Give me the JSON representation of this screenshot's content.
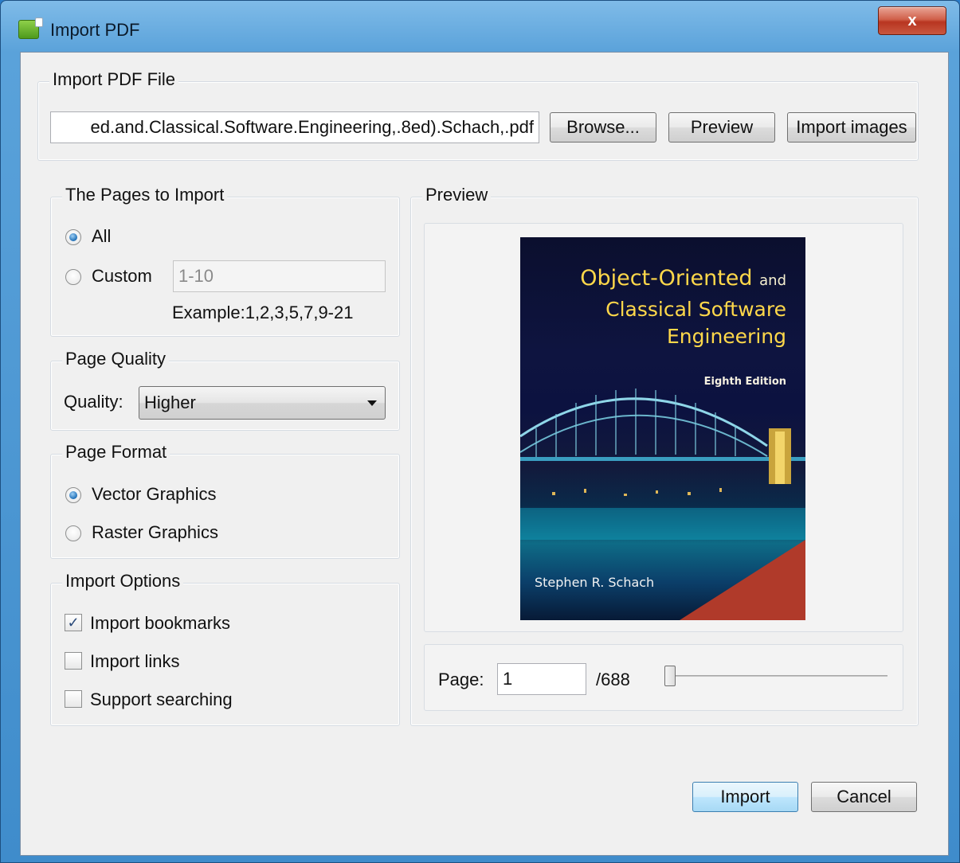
{
  "window": {
    "title": "Import PDF",
    "close_label": "x"
  },
  "file_group": {
    "title": "Import PDF File",
    "path_value": "ed.and.Classical.Software.Engineering,.8ed).Schach,.pdf",
    "browse_label": "Browse...",
    "preview_label": "Preview",
    "import_images_label": "Import images"
  },
  "pages_group": {
    "title": "The Pages to Import",
    "all_label": "All",
    "custom_label": "Custom",
    "custom_placeholder": "1-10",
    "example_text": "Example:1,2,3,5,7,9-21",
    "selected": "All"
  },
  "quality_group": {
    "title": "Page Quality",
    "quality_label": "Quality:",
    "quality_value": "Higher"
  },
  "format_group": {
    "title": "Page Format",
    "vector_label": "Vector Graphics",
    "raster_label": "Raster Graphics",
    "selected": "Vector Graphics"
  },
  "options_group": {
    "title": "Import Options",
    "bookmarks_label": "Import bookmarks",
    "bookmarks_checked": true,
    "links_label": "Import links",
    "links_checked": false,
    "searching_label": "Support searching",
    "searching_checked": false
  },
  "preview_group": {
    "title": "Preview",
    "cover": {
      "title_line1": "Object-Oriented",
      "title_and": "and",
      "title_line2": "Classical Software",
      "title_line3": "Engineering",
      "edition": "Eighth Edition",
      "author": "Stephen R. Schach"
    },
    "page_label": "Page:",
    "page_value": "1",
    "page_total": "/688",
    "slider_position": 0.0
  },
  "footer": {
    "import_label": "Import",
    "cancel_label": "Cancel"
  }
}
